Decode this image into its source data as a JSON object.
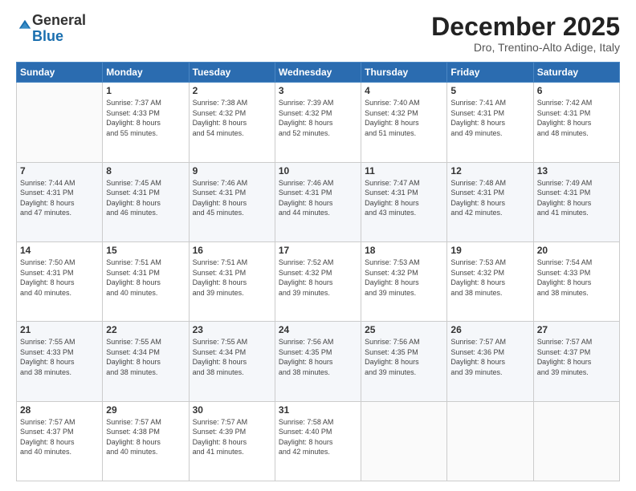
{
  "logo": {
    "general": "General",
    "blue": "Blue"
  },
  "header": {
    "month": "December 2025",
    "location": "Dro, Trentino-Alto Adige, Italy"
  },
  "weekdays": [
    "Sunday",
    "Monday",
    "Tuesday",
    "Wednesday",
    "Thursday",
    "Friday",
    "Saturday"
  ],
  "weeks": [
    [
      {
        "day": "",
        "info": ""
      },
      {
        "day": "1",
        "info": "Sunrise: 7:37 AM\nSunset: 4:33 PM\nDaylight: 8 hours\nand 55 minutes."
      },
      {
        "day": "2",
        "info": "Sunrise: 7:38 AM\nSunset: 4:32 PM\nDaylight: 8 hours\nand 54 minutes."
      },
      {
        "day": "3",
        "info": "Sunrise: 7:39 AM\nSunset: 4:32 PM\nDaylight: 8 hours\nand 52 minutes."
      },
      {
        "day": "4",
        "info": "Sunrise: 7:40 AM\nSunset: 4:32 PM\nDaylight: 8 hours\nand 51 minutes."
      },
      {
        "day": "5",
        "info": "Sunrise: 7:41 AM\nSunset: 4:31 PM\nDaylight: 8 hours\nand 49 minutes."
      },
      {
        "day": "6",
        "info": "Sunrise: 7:42 AM\nSunset: 4:31 PM\nDaylight: 8 hours\nand 48 minutes."
      }
    ],
    [
      {
        "day": "7",
        "info": "Sunrise: 7:44 AM\nSunset: 4:31 PM\nDaylight: 8 hours\nand 47 minutes."
      },
      {
        "day": "8",
        "info": "Sunrise: 7:45 AM\nSunset: 4:31 PM\nDaylight: 8 hours\nand 46 minutes."
      },
      {
        "day": "9",
        "info": "Sunrise: 7:46 AM\nSunset: 4:31 PM\nDaylight: 8 hours\nand 45 minutes."
      },
      {
        "day": "10",
        "info": "Sunrise: 7:46 AM\nSunset: 4:31 PM\nDaylight: 8 hours\nand 44 minutes."
      },
      {
        "day": "11",
        "info": "Sunrise: 7:47 AM\nSunset: 4:31 PM\nDaylight: 8 hours\nand 43 minutes."
      },
      {
        "day": "12",
        "info": "Sunrise: 7:48 AM\nSunset: 4:31 PM\nDaylight: 8 hours\nand 42 minutes."
      },
      {
        "day": "13",
        "info": "Sunrise: 7:49 AM\nSunset: 4:31 PM\nDaylight: 8 hours\nand 41 minutes."
      }
    ],
    [
      {
        "day": "14",
        "info": "Sunrise: 7:50 AM\nSunset: 4:31 PM\nDaylight: 8 hours\nand 40 minutes."
      },
      {
        "day": "15",
        "info": "Sunrise: 7:51 AM\nSunset: 4:31 PM\nDaylight: 8 hours\nand 40 minutes."
      },
      {
        "day": "16",
        "info": "Sunrise: 7:51 AM\nSunset: 4:31 PM\nDaylight: 8 hours\nand 39 minutes."
      },
      {
        "day": "17",
        "info": "Sunrise: 7:52 AM\nSunset: 4:32 PM\nDaylight: 8 hours\nand 39 minutes."
      },
      {
        "day": "18",
        "info": "Sunrise: 7:53 AM\nSunset: 4:32 PM\nDaylight: 8 hours\nand 39 minutes."
      },
      {
        "day": "19",
        "info": "Sunrise: 7:53 AM\nSunset: 4:32 PM\nDaylight: 8 hours\nand 38 minutes."
      },
      {
        "day": "20",
        "info": "Sunrise: 7:54 AM\nSunset: 4:33 PM\nDaylight: 8 hours\nand 38 minutes."
      }
    ],
    [
      {
        "day": "21",
        "info": "Sunrise: 7:55 AM\nSunset: 4:33 PM\nDaylight: 8 hours\nand 38 minutes."
      },
      {
        "day": "22",
        "info": "Sunrise: 7:55 AM\nSunset: 4:34 PM\nDaylight: 8 hours\nand 38 minutes."
      },
      {
        "day": "23",
        "info": "Sunrise: 7:55 AM\nSunset: 4:34 PM\nDaylight: 8 hours\nand 38 minutes."
      },
      {
        "day": "24",
        "info": "Sunrise: 7:56 AM\nSunset: 4:35 PM\nDaylight: 8 hours\nand 38 minutes."
      },
      {
        "day": "25",
        "info": "Sunrise: 7:56 AM\nSunset: 4:35 PM\nDaylight: 8 hours\nand 39 minutes."
      },
      {
        "day": "26",
        "info": "Sunrise: 7:57 AM\nSunset: 4:36 PM\nDaylight: 8 hours\nand 39 minutes."
      },
      {
        "day": "27",
        "info": "Sunrise: 7:57 AM\nSunset: 4:37 PM\nDaylight: 8 hours\nand 39 minutes."
      }
    ],
    [
      {
        "day": "28",
        "info": "Sunrise: 7:57 AM\nSunset: 4:37 PM\nDaylight: 8 hours\nand 40 minutes."
      },
      {
        "day": "29",
        "info": "Sunrise: 7:57 AM\nSunset: 4:38 PM\nDaylight: 8 hours\nand 40 minutes."
      },
      {
        "day": "30",
        "info": "Sunrise: 7:57 AM\nSunset: 4:39 PM\nDaylight: 8 hours\nand 41 minutes."
      },
      {
        "day": "31",
        "info": "Sunrise: 7:58 AM\nSunset: 4:40 PM\nDaylight: 8 hours\nand 42 minutes."
      },
      {
        "day": "",
        "info": ""
      },
      {
        "day": "",
        "info": ""
      },
      {
        "day": "",
        "info": ""
      }
    ]
  ]
}
